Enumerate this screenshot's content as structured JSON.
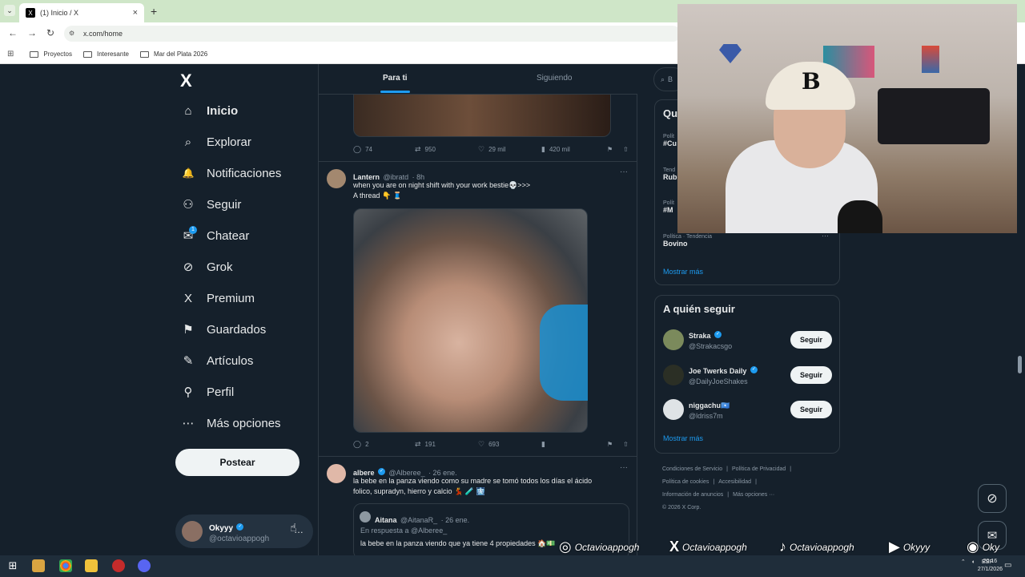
{
  "browser": {
    "tab_title": "(1) Inicio / X",
    "tab_close": "×",
    "tab_menu": "⌄",
    "new_tab": "+",
    "favicon_text": "X",
    "url": "x.com/home",
    "bookmarks": [
      "Proyectos",
      "Interesante",
      "Mar del Plata 2026"
    ]
  },
  "nav": {
    "logo": "X",
    "items": [
      {
        "label": "Inicio",
        "icon": "home-icon",
        "glyph": "⌂"
      },
      {
        "label": "Explorar",
        "icon": "search-icon",
        "glyph": "⌕"
      },
      {
        "label": "Notificaciones",
        "icon": "bell-icon",
        "glyph": "🔔"
      },
      {
        "label": "Seguir",
        "icon": "add-person-icon",
        "glyph": "⚇"
      },
      {
        "label": "Chatear",
        "icon": "mail-icon",
        "glyph": "✉"
      },
      {
        "label": "Grok",
        "icon": "grok-icon",
        "glyph": "⊘"
      },
      {
        "label": "Premium",
        "icon": "x-premium-icon",
        "glyph": "X"
      },
      {
        "label": "Guardados",
        "icon": "bookmark-icon",
        "glyph": "⚑"
      },
      {
        "label": "Artículos",
        "icon": "article-icon",
        "glyph": "✎"
      },
      {
        "label": "Perfil",
        "icon": "profile-icon",
        "glyph": "⚲"
      },
      {
        "label": "Más opciones",
        "icon": "more-options-icon",
        "glyph": "⋯"
      }
    ],
    "chat_badge": "1",
    "post_label": "Postear",
    "account": {
      "name": "Okyyy",
      "handle": "@octavioappogh",
      "more": "…"
    }
  },
  "feed": {
    "tabs": [
      "Para ti",
      "Siguiendo"
    ],
    "tweet0_actions": {
      "replies": "74",
      "retweets": "950",
      "likes": "29 mil",
      "views": "420 mil"
    },
    "tweet1": {
      "name": "Lantern",
      "handle": "@ibratd",
      "time": "· 8h",
      "text_line1": "when you are on night shift with your work bestie💀>>>",
      "text_line2": "A thread 👇 🧵",
      "actions": {
        "replies": "2",
        "retweets": "191",
        "likes": "693",
        "views": ""
      }
    },
    "tweet2": {
      "name": "albere",
      "handle": "@Alberee_",
      "time": "· 26 ene.",
      "text_line1": "la bebe en la panza viendo como su madre se tomó todos los días el ácido",
      "text_line2": "folico, supradyn, hierro y calcio 💃 🧪 🩻",
      "quote": {
        "name": "Aitana",
        "handle": "@AitanaR_",
        "time": "· 26 ene.",
        "reply_to": "En respuesta a @Alberee_",
        "text": "la bebe en la panza viendo que ya tiene 4 propiedades 🏠💵"
      }
    }
  },
  "sidebar": {
    "search_placeholder": "B",
    "trends_title": "Qu",
    "trends": [
      {
        "label": "Polít",
        "name": "#Cu"
      },
      {
        "label": "Tend",
        "name": "Rub"
      },
      {
        "label": "Polít",
        "name": "#M"
      },
      {
        "label": "Política · Tendencia",
        "name": "Bovino"
      }
    ],
    "trends_more": "Mostrar más",
    "who_to_follow_title": "A quién seguir",
    "suggestions": [
      {
        "name": "Straka",
        "handle": "@Strakacsgo",
        "button": "Seguir",
        "verified": true
      },
      {
        "name": "Joe Twerks Daily",
        "handle": "@DailyJoeShakes",
        "button": "Seguir",
        "verified": true
      },
      {
        "name": "niggachu🇸🇴",
        "handle": "@ldriss7m",
        "button": "Seguir",
        "verified": false
      }
    ],
    "follow_more": "Mostrar más",
    "footer": {
      "line1a": "Condiciones de Servicio",
      "line1b": "Política de Privacidad",
      "line2a": "Política de cookies",
      "line2b": "Accesibilidad",
      "line3a": "Información de anuncios",
      "line3b": "Más opciones ···",
      "line4": "© 2026 X Corp."
    }
  },
  "stream_overlay": {
    "instagram": "Octavioappogh",
    "x": "Octavioappogh",
    "tiktok": "Octavioappogh",
    "youtube": "Okyyy",
    "spotify": "Oky"
  },
  "taskbar": {
    "lang": "ESP",
    "time": "20:16",
    "date": "27/1/2026"
  },
  "colors": {
    "bg": "#15202b",
    "accent": "#1d9bf0",
    "border": "#2f3a44",
    "muted": "#8b98a5"
  }
}
